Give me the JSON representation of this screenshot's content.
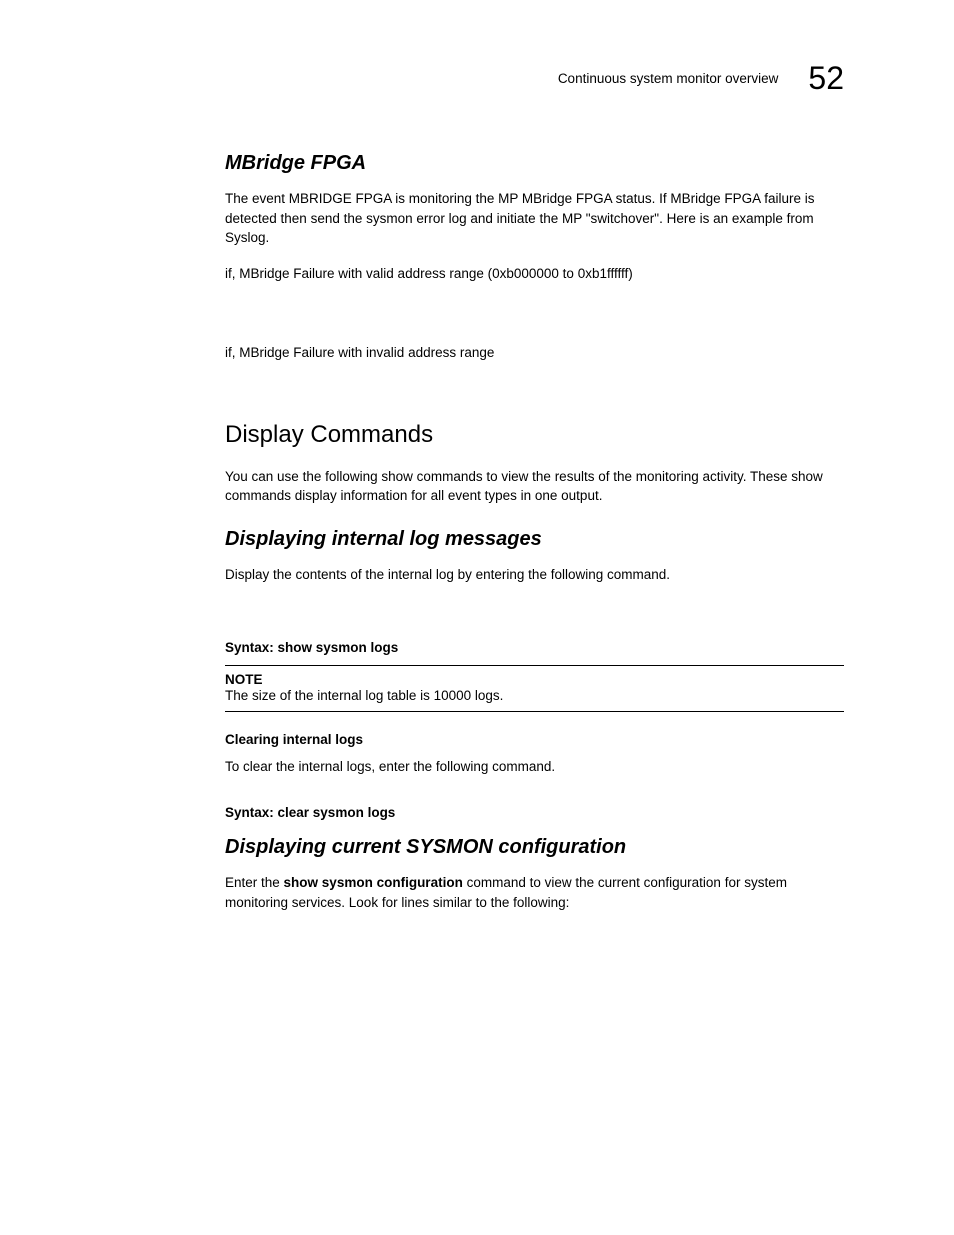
{
  "header": {
    "title": "Continuous system monitor overview",
    "pageNumber": "52"
  },
  "section1": {
    "heading": "MBridge FPGA",
    "para1": "The event MBRIDGE FPGA is monitoring the MP MBridge FPGA status. If MBridge FPGA failure is detected then send the sysmon error log and initiate the MP \"switchover\". Here is an example from Syslog.",
    "para2": "if, MBridge Failure with valid address range (0xb000000 to 0xb1ffffff)",
    "para3": "if, MBridge Failure with invalid address range"
  },
  "section2": {
    "heading": "Display Commands",
    "para1": "You can use the following show commands to view the results of the monitoring activity. These show commands display information for all event types in one output."
  },
  "section3": {
    "heading": "Displaying internal log messages",
    "para1": "Display the contents of the internal log by entering the following command.",
    "syntax1": "Syntax:  show sysmon logs",
    "noteLabel": "NOTE",
    "noteText": "The size of the internal log table is 10000 logs.",
    "subHeading": "Clearing internal logs",
    "para2": "To clear the internal logs, enter the following command.",
    "syntax2": "Syntax:  clear sysmon logs"
  },
  "section4": {
    "heading": "Displaying current SYSMON configuration",
    "para1_prefix": "Enter the ",
    "para1_bold": "show sysmon configuration",
    "para1_suffix": " command to view the current configuration for system monitoring services. Look for lines similar to the following:"
  }
}
